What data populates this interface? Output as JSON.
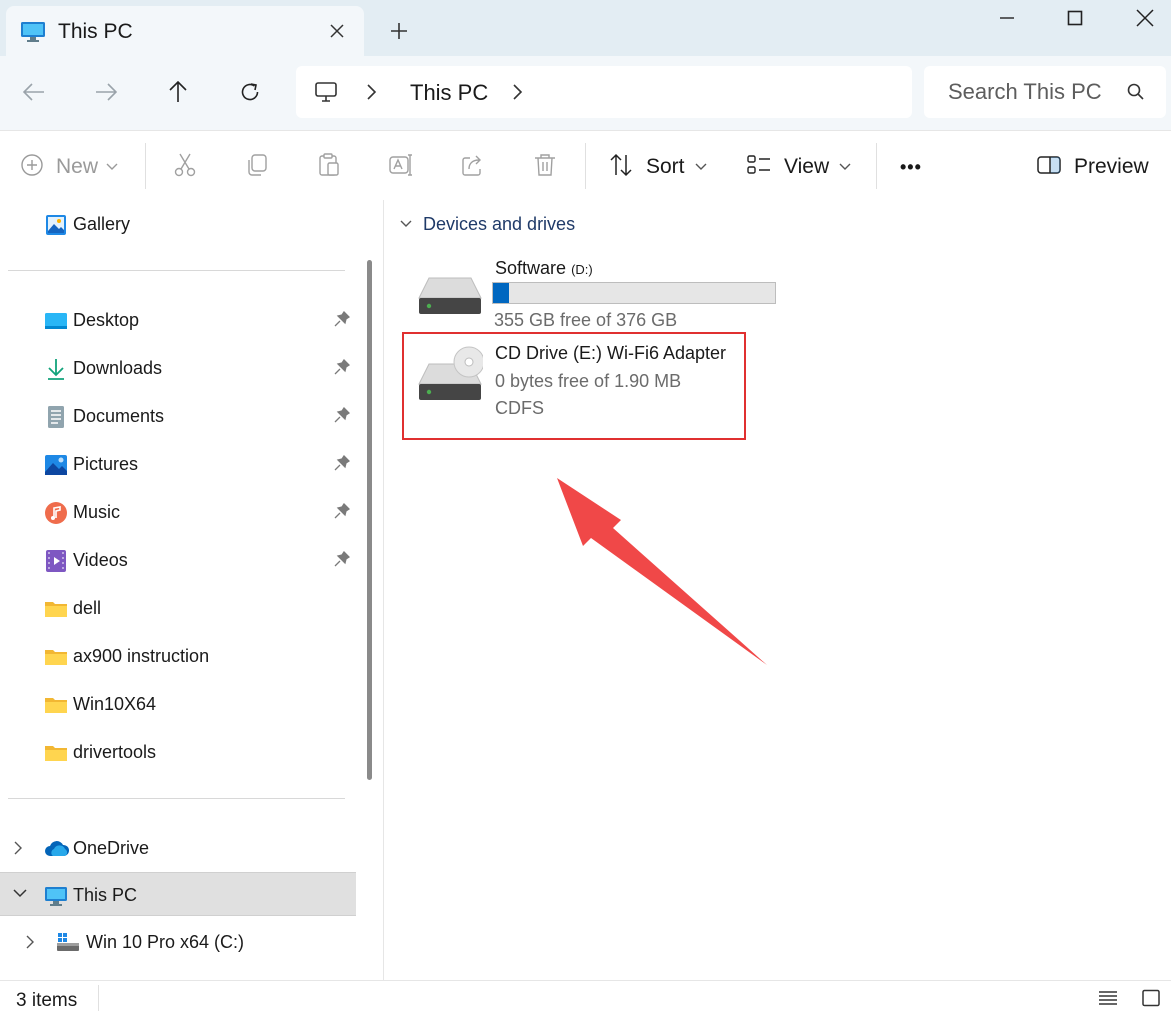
{
  "window": {
    "tab_title": "This PC",
    "new_tab": "+"
  },
  "nav": {
    "breadcrumb": [
      "This PC"
    ],
    "search_placeholder": "Search This PC"
  },
  "toolbar": {
    "new_label": "New",
    "sort_label": "Sort",
    "view_label": "View",
    "more_label": "•••",
    "preview_label": "Preview"
  },
  "sidebar": {
    "gallery": "Gallery",
    "quick_access": [
      {
        "label": "Desktop",
        "icon": "desktop-icon",
        "pinned": true
      },
      {
        "label": "Downloads",
        "icon": "downloads-icon",
        "pinned": true
      },
      {
        "label": "Documents",
        "icon": "documents-icon",
        "pinned": true
      },
      {
        "label": "Pictures",
        "icon": "pictures-icon",
        "pinned": true
      },
      {
        "label": "Music",
        "icon": "music-icon",
        "pinned": true
      },
      {
        "label": "Videos",
        "icon": "videos-icon",
        "pinned": true
      },
      {
        "label": "dell",
        "icon": "folder-icon",
        "pinned": false
      },
      {
        "label": "ax900 instruction",
        "icon": "folder-icon",
        "pinned": false
      },
      {
        "label": "Win10X64",
        "icon": "folder-icon",
        "pinned": false
      },
      {
        "label": "drivertools",
        "icon": "folder-icon",
        "pinned": false
      }
    ],
    "onedrive": "OneDrive",
    "this_pc": "This PC",
    "c_drive": "Win 10 Pro x64 (C:)"
  },
  "content": {
    "group_title": "Devices and drives",
    "drives": [
      {
        "name": "Software",
        "letter": "(D:)",
        "free_text": "355 GB free of 376 GB",
        "used_fraction": 0.056,
        "icon": "hard-drive-icon"
      },
      {
        "name": "CD Drive (E:) Wi-Fi6 Adapter",
        "free_text": "0 bytes free of 1.90 MB",
        "filesystem": "CDFS",
        "icon": "cd-drive-icon",
        "highlighted": true
      }
    ]
  },
  "status": {
    "items_count": "3 items"
  },
  "colors": {
    "accent": "#0067c0",
    "highlight": "#e03030",
    "arrow": "#f04848",
    "titlebar": "#e3edf3"
  }
}
